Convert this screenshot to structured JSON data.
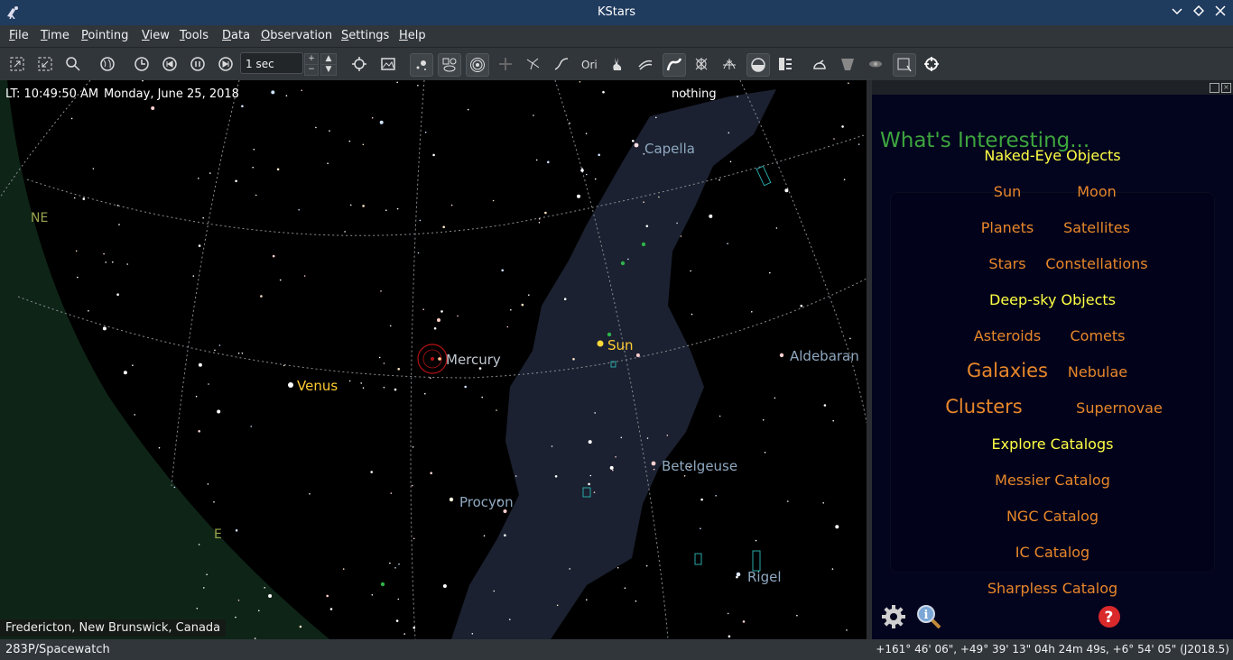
{
  "window": {
    "title": "KStars"
  },
  "menu": [
    "File",
    "Time",
    "Pointing",
    "View",
    "Tools",
    "Data",
    "Observation",
    "Settings",
    "Help"
  ],
  "toolbar": {
    "time_step": "1 sec"
  },
  "sky": {
    "local_time": "LT: 10:49:50 AM",
    "date": "Monday, June 25, 2018",
    "focus_object": "nothing",
    "location": "Fredericton, New Brunswick, Canada",
    "compass": {
      "ne": "NE",
      "e": "E"
    },
    "labels": {
      "capella": "Capella",
      "sun": "Sun",
      "mercury": "Mercury",
      "venus": "Venus",
      "aldebaran": "Aldebaran",
      "betelgeuse": "Betelgeuse",
      "procyon": "Procyon",
      "rigel": "Rigel"
    }
  },
  "whats_interesting": {
    "title": "What's Interesting...",
    "naked_eye_heading": "Naked-Eye Objects",
    "sun": "Sun",
    "moon": "Moon",
    "planets": "Planets",
    "satellites": "Satellites",
    "stars": "Stars",
    "constellations": "Constellations",
    "deep_sky_heading": "Deep-sky Objects",
    "asteroids": "Asteroids",
    "comets": "Comets",
    "galaxies": "Galaxies",
    "nebulae": "Nebulae",
    "clusters": "Clusters",
    "supernovae": "Supernovae",
    "catalogs_heading": "Explore Catalogs",
    "messier": "Messier Catalog",
    "ngc": "NGC Catalog",
    "ic": "IC Catalog",
    "sharpless": "Sharpless Catalog"
  },
  "status": {
    "left": "283P/Spacewatch",
    "right": "+161° 46' 06\", +49° 39' 13\"  04h 24m 49s, +6° 54' 05\" (J2018.5)"
  },
  "colors": {
    "heading_yellow": "#ffff44",
    "item_orange": "#e8872a",
    "title_green": "#3ea53e",
    "horizon_green": "#0e2417",
    "milky_way": "#1b2130"
  }
}
